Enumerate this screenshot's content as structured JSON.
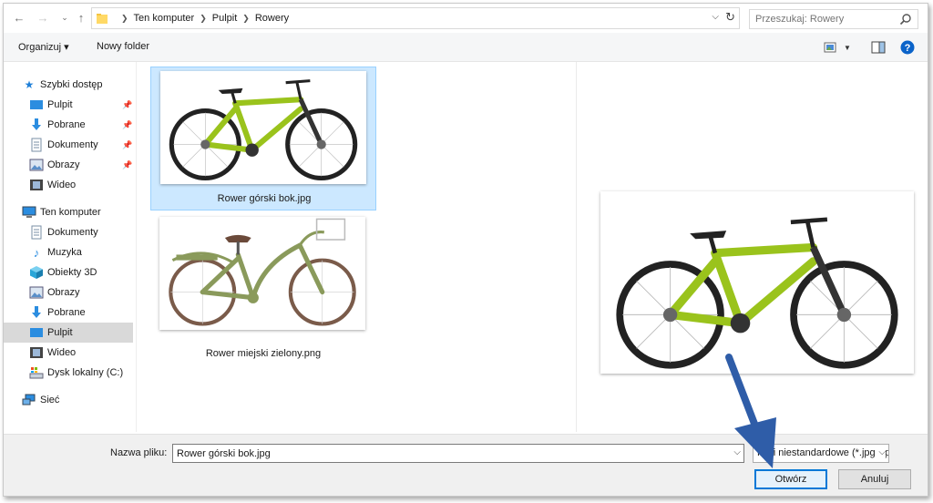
{
  "address_bar": {
    "breadcrumbs": [
      "Ten komputer",
      "Pulpit",
      "Rowery"
    ],
    "search_placeholder": "Przeszukaj: Rowery"
  },
  "toolbar": {
    "organize_label": "Organizuj ▾",
    "new_folder_label": "Nowy folder"
  },
  "sidebar": {
    "items": [
      {
        "label": "Szybki dostęp",
        "icon": "star-icon",
        "pinned": false
      },
      {
        "label": "Pulpit",
        "icon": "desktop-icon",
        "pinned": true
      },
      {
        "label": "Pobrane",
        "icon": "download-icon",
        "pinned": true
      },
      {
        "label": "Dokumenty",
        "icon": "document-icon",
        "pinned": true
      },
      {
        "label": "Obrazy",
        "icon": "pictures-icon",
        "pinned": true
      },
      {
        "label": "Wideo",
        "icon": "video-icon",
        "pinned": false
      },
      {
        "label": "Ten komputer",
        "icon": "computer-icon",
        "pinned": false
      },
      {
        "label": "Dokumenty",
        "icon": "document-icon",
        "pinned": false
      },
      {
        "label": "Muzyka",
        "icon": "music-icon",
        "pinned": false
      },
      {
        "label": "Obiekty 3D",
        "icon": "cube-icon",
        "pinned": false
      },
      {
        "label": "Obrazy",
        "icon": "pictures-icon",
        "pinned": false
      },
      {
        "label": "Pobrane",
        "icon": "download-icon",
        "pinned": false
      },
      {
        "label": "Pulpit",
        "icon": "desktop-icon",
        "pinned": false,
        "selected": true
      },
      {
        "label": "Wideo",
        "icon": "video-icon",
        "pinned": false
      },
      {
        "label": "Dysk lokalny (C:)",
        "icon": "drive-icon",
        "pinned": false
      },
      {
        "label": "Sieć",
        "icon": "network-icon",
        "pinned": false
      }
    ]
  },
  "files": [
    {
      "name": "Rower górski bok.jpg",
      "selected": true,
      "thumbnail": "green-mountain-bike"
    },
    {
      "name": "Rower miejski zielony.png",
      "selected": false,
      "thumbnail": "green-city-bike"
    }
  ],
  "preview": {
    "image": "green-mountain-bike"
  },
  "bottom": {
    "filename_label": "Nazwa pliku:",
    "filename_value": "Rower górski bok.jpg",
    "filetype_value": "Pliki niestandardowe (*.jpg;*.pr",
    "open_label": "Otwórz",
    "cancel_label": "Anuluj"
  },
  "colors": {
    "accent": "#0078d7",
    "selection_bg": "#cce8ff",
    "bike_green": "#9ac31c",
    "city_bike_green": "#8a9a5b",
    "annotation_arrow": "#2f5da8"
  }
}
